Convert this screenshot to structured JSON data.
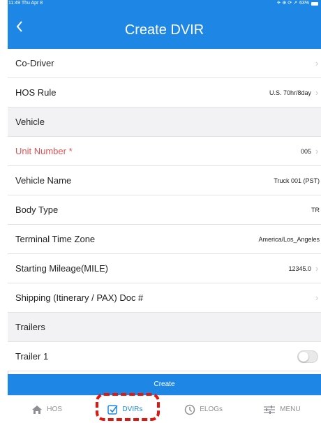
{
  "status_bar": {
    "time": "11:49",
    "date": "Thu Apr 8",
    "icons": "✈ ⊕ ⟳ ↗",
    "battery": "63%"
  },
  "nav": {
    "back_icon": "chevron-left-icon",
    "title": "Create DVIR"
  },
  "rows": [
    {
      "label": "Co-Driver",
      "value": "",
      "chevron": true,
      "section": false,
      "required": false
    },
    {
      "label": "HOS Rule",
      "value": "U.S. 70hr/8day",
      "chevron": true,
      "section": false,
      "required": false
    },
    {
      "label": "Vehicle",
      "value": "",
      "chevron": false,
      "section": true,
      "required": false
    },
    {
      "label": "Unit Number *",
      "value": "005",
      "chevron": true,
      "section": false,
      "required": true
    },
    {
      "label": "Vehicle Name",
      "value": "Truck 001 (PST)",
      "chevron": false,
      "section": false,
      "required": false
    },
    {
      "label": "Body Type",
      "value": "TR",
      "chevron": false,
      "section": false,
      "required": false
    },
    {
      "label": "Terminal Time Zone",
      "value": "America/Los_Angeles",
      "chevron": false,
      "section": false,
      "required": false
    },
    {
      "label": "Starting Mileage(MILE)",
      "value": "12345.0",
      "chevron": true,
      "section": false,
      "required": false
    },
    {
      "label": "Shipping (Itinerary / PAX) Doc #",
      "value": "",
      "chevron": true,
      "section": false,
      "required": false
    },
    {
      "label": "Trailers",
      "value": "",
      "chevron": false,
      "section": true,
      "required": false
    }
  ],
  "trailer_row": {
    "label": "Trailer 1",
    "toggle_on": false
  },
  "create_button": "Create",
  "tabs": [
    {
      "label": "HOS",
      "icon": "home-icon",
      "active": false
    },
    {
      "label": "DVIRs",
      "icon": "checkbox-icon",
      "active": true
    },
    {
      "label": "ELOGs",
      "icon": "timer-icon",
      "active": false
    },
    {
      "label": "MENU",
      "icon": "sliders-icon",
      "active": false
    }
  ],
  "colors": {
    "accent": "#1e86e4",
    "required": "#e05252",
    "highlight": "#e0160f"
  }
}
